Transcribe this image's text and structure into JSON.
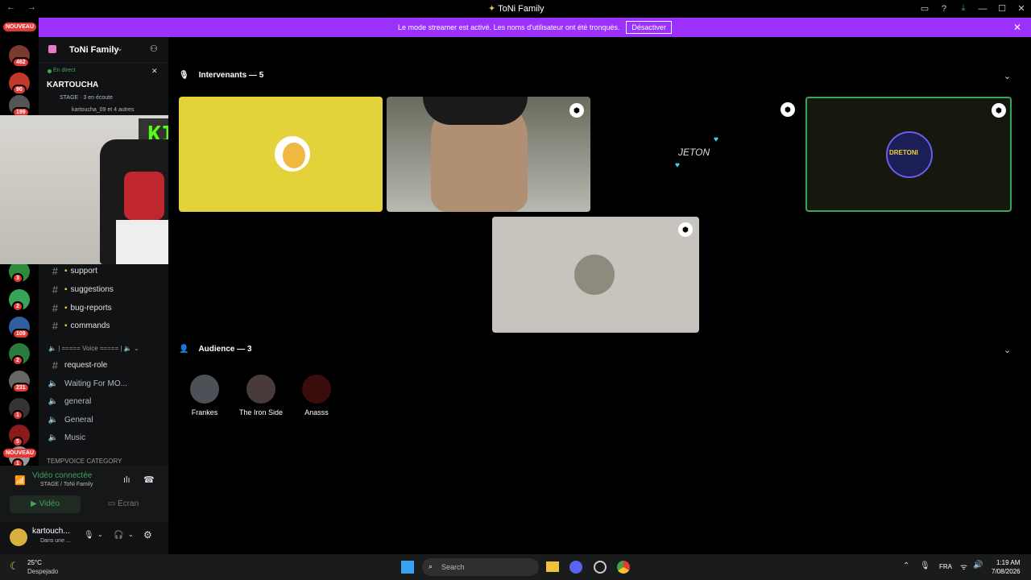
{
  "window": {
    "title": "ToNi Family",
    "title_icon": "pin-icon"
  },
  "banner": {
    "text": "Le mode streamer est activé. Les noms d'utilisateur ont été tronqués.",
    "button": "Désactiver"
  },
  "rail": {
    "nouveau_top": "NOUVEAU",
    "nouveau_bottom": "NOUVEAU",
    "servers": [
      {
        "badge": "462",
        "color": "#7a3b2e"
      },
      {
        "badge": "90",
        "color": "#c0392b"
      },
      {
        "badge": "199",
        "color": "#555"
      },
      {
        "badge": "3",
        "color": "#2d8c3c"
      },
      {
        "badge": "2",
        "color": "#3aa35a"
      },
      {
        "badge": "109",
        "color": "#2f5d9e"
      },
      {
        "badge": "2",
        "color": "#2b7a3d"
      },
      {
        "badge": "231",
        "color": "#666"
      },
      {
        "badge": "1",
        "color": "#333"
      },
      {
        "badge": "5",
        "color": "#8b1a1a"
      },
      {
        "badge": "1",
        "color": "#999"
      }
    ]
  },
  "channel_panel": {
    "server_name": "ToNi Family",
    "live_label": "En direct",
    "stage_title": "KARTOUCHA",
    "stage_meta": "STAGE · 3 en écoute",
    "stage_listeners": "kartoucha_09 et 4 autres",
    "channels": [
      {
        "type": "text",
        "name": "support",
        "emoji": "folder"
      },
      {
        "type": "text",
        "name": "suggestions",
        "emoji": "bars"
      },
      {
        "type": "text",
        "name": "bug-reports",
        "emoji": "folder"
      },
      {
        "type": "text",
        "name": "commands",
        "emoji": "robot"
      }
    ],
    "voice_divider": "| ===== Voice ===== |",
    "channels2": [
      {
        "type": "text",
        "name": "request-role"
      },
      {
        "type": "voice",
        "name": "Waiting For MO..."
      },
      {
        "type": "voice",
        "name": "general"
      },
      {
        "type": "voice",
        "name": "General"
      },
      {
        "type": "voice",
        "name": "Music"
      }
    ],
    "category": "TEMPVOICE CATEGORY"
  },
  "voice_status": {
    "title": "Vidéo connectée",
    "subtitle": "STAGE / ToNi Family",
    "video_btn": "Vidéo",
    "screen_btn": "Écran"
  },
  "user": {
    "name": "kartouch...",
    "status": "Dans une ..."
  },
  "main": {
    "speakers_header": "Intervenants — 5",
    "audience_header": "Audience — 3",
    "audience": [
      {
        "name": "Frankes",
        "color": "#4e5058"
      },
      {
        "name": "The Iron Side",
        "color": "#4a3b3b"
      },
      {
        "name": "Anasss",
        "color": "#3a0c0c"
      }
    ],
    "tile_labels": {
      "jeton": "JETON",
      "dretoni": "DRETONI"
    }
  },
  "webcam": {
    "sign": "KICK"
  },
  "taskbar": {
    "weather_temp": "25°C",
    "weather_desc": "Despejado",
    "search": "Search",
    "lang": "FRA",
    "time": "1:19 AM",
    "date": "7/08/2026"
  }
}
